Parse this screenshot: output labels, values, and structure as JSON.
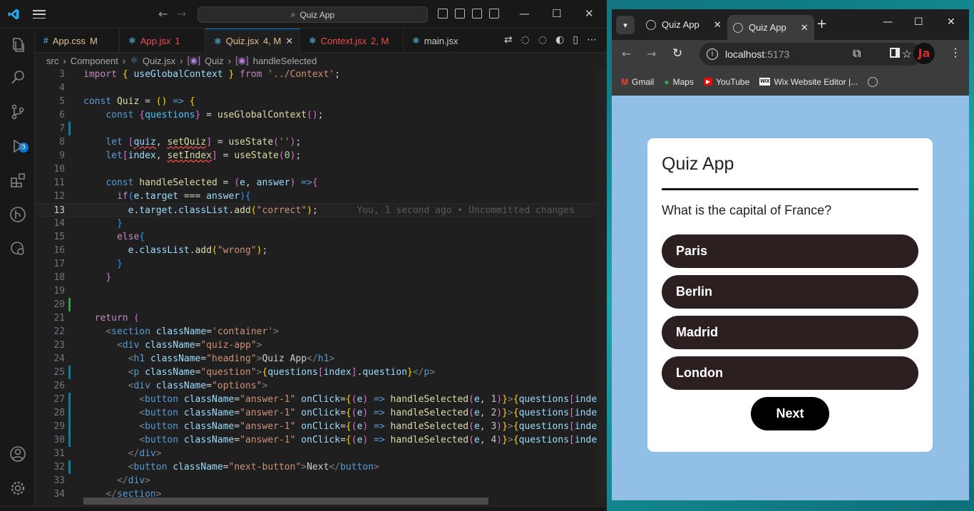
{
  "vscode": {
    "command_center": "Quiz App",
    "tabs": [
      {
        "label": "App.css",
        "status": "M",
        "icon": "css-icon",
        "color": "#e2c08d"
      },
      {
        "label": "App.jsx",
        "status": "1",
        "icon": "react-icon",
        "color": "#f14c4c"
      },
      {
        "label": "Quiz.jsx",
        "status": "4, M",
        "icon": "react-icon",
        "color": "#e2c08d"
      },
      {
        "label": "Context.jsx",
        "status": "2, M",
        "icon": "react-icon",
        "color": "#f14c4c"
      },
      {
        "label": "main.jsx",
        "status": "",
        "icon": "react-icon",
        "color": "#ccc"
      }
    ],
    "breadcrumb": [
      "src",
      "Component",
      "Quiz.jsx",
      "Quiz",
      "handleSelected"
    ],
    "scm_badge": "3",
    "blame": "You, 1 second ago • Uncommitted changes"
  },
  "browser": {
    "tabs": [
      "Quiz App",
      "Quiz App"
    ],
    "url_host": "localhost",
    "url_port": ":5173",
    "bookmarks": [
      "Gmail",
      "Maps",
      "YouTube",
      "Wix Website Editor |..."
    ]
  },
  "quiz": {
    "heading": "Quiz App",
    "question": "What is the capital of France?",
    "answers": [
      "Paris",
      "Berlin",
      "Madrid",
      "London"
    ],
    "next_label": "Next",
    "answer_bg": "#2b1f1f",
    "page_bg": "#92bfe6"
  }
}
